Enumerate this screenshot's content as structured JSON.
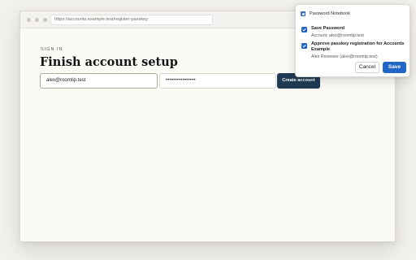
{
  "browser": {
    "url": "https://accounts.example.test/register-passkey"
  },
  "page": {
    "eyebrow": "SIGN IN",
    "title": "Finish account setup",
    "email_value": "alex@roomtip.test",
    "password_value": "••••••••••••••••",
    "create_button": "Create account"
  },
  "popup": {
    "title": "Password Notebook",
    "icon": "notebook-icon",
    "options": [
      {
        "label": "Save Password",
        "detail": "Account: alex@roomtip.test",
        "checked": true
      },
      {
        "label": "Approve passkey registration for Accounts Example",
        "detail": "Alex Reviewer (alex@roomtip.test)",
        "checked": true
      }
    ],
    "cancel_label": "Cancel",
    "save_label": "Save",
    "accent_color": "#2166c4"
  }
}
